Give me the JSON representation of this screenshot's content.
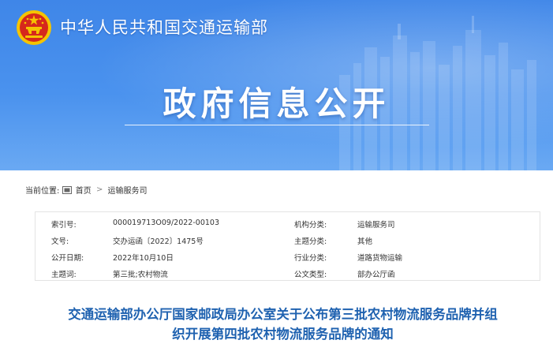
{
  "header": {
    "ministry_name": "中华人民共和国交通运输部",
    "banner_title": "政府信息公开"
  },
  "breadcrumb": {
    "prefix": "当前位置:",
    "items": [
      "首页",
      "运输服务司"
    ],
    "separator": ">"
  },
  "info": {
    "rows": [
      {
        "label1": "索引号:",
        "value1": "000019713O09/2022-00103",
        "label2": "机构分类:",
        "value2": "运输服务司"
      },
      {
        "label1": "文号:",
        "value1": "交办运函〔2022〕1475号",
        "label2": "主题分类:",
        "value2": "其他"
      },
      {
        "label1": "公开日期:",
        "value1": "2022年10月10日",
        "label2": "行业分类:",
        "value2": "道路货物运输"
      },
      {
        "label1": "主题词:",
        "value1": "第三批;农村物流",
        "label2": "公文类型:",
        "value2": "部办公厅函"
      }
    ]
  },
  "article": {
    "title_line1": "交通运输部办公厅国家邮政局办公室关于公布第三批农村物流服务品牌并组",
    "title_line2": "织开展第四批农村物流服务品牌的通知"
  },
  "colors": {
    "banner_blue": "#4a92ee",
    "title_blue": "#1f62b0",
    "emblem_red": "#d6281c",
    "emblem_gold": "#f5c400"
  }
}
